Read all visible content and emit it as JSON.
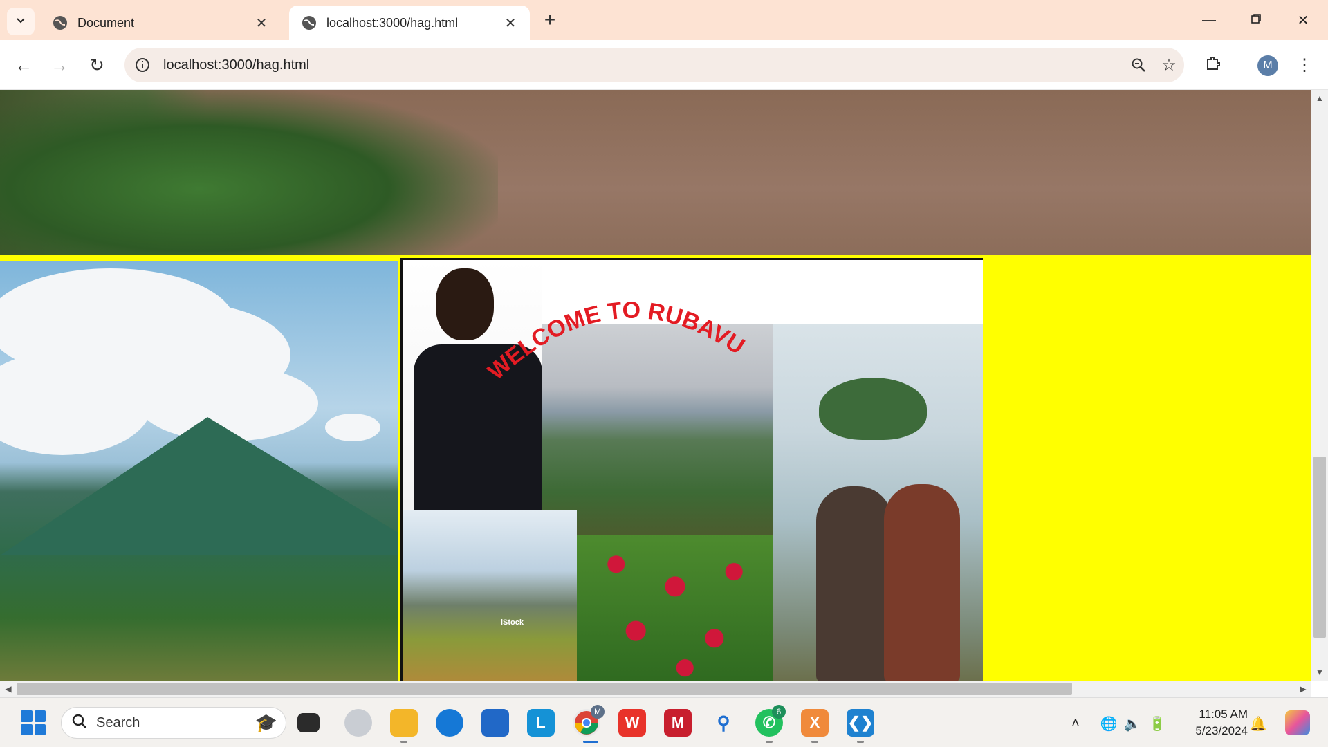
{
  "browser": {
    "tabs": [
      {
        "label": "Document",
        "active": false
      },
      {
        "label": "localhost:3000/hag.html",
        "active": true
      }
    ],
    "url": "localhost:3000/hag.html",
    "profile_initial": "M"
  },
  "page": {
    "background_color": "#ffff00",
    "collage_banner": "WELCOME TO RUBAVU",
    "collage_watermark": "iStock"
  },
  "taskbar": {
    "search_label": "Search",
    "whatsapp_badge": "6",
    "chrome_badge": "M",
    "time": "11:05 AM",
    "date": "5/23/2024"
  }
}
